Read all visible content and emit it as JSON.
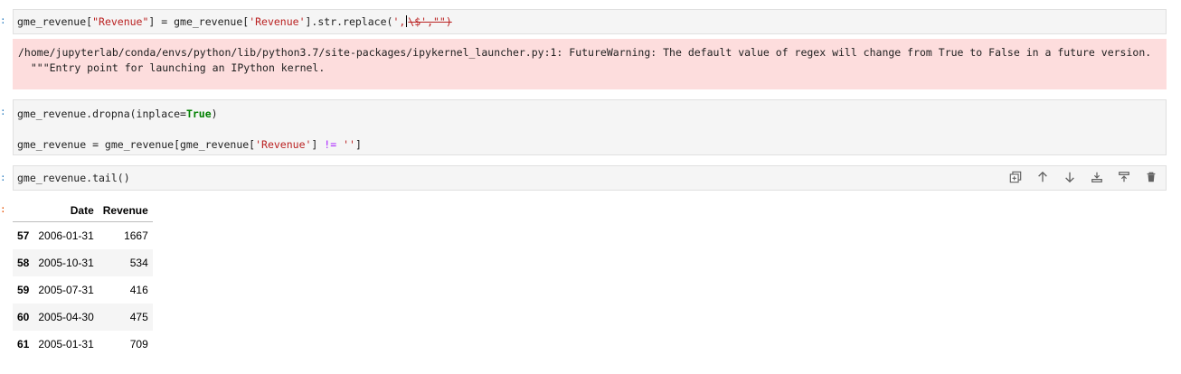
{
  "cells": [
    {
      "prompt": ":",
      "code_parts": {
        "a": "gme_revenue[",
        "b": "\"Revenue\"",
        "c": "] = gme_revenue[",
        "d": "'Revenue'",
        "e": "].str.replace(",
        "f": "',",
        "g": "\\$',\"\")"
      }
    },
    {
      "stderr": "/home/jupyterlab/conda/envs/python/lib/python3.7/site-packages/ipykernel_launcher.py:1: FutureWarning: The default value of regex will change from True to False in a future version.\n  \"\"\"Entry point for launching an IPython kernel."
    },
    {
      "prompt": ":",
      "line1": {
        "a": "gme_revenue.dropna(inplace=",
        "b": "True",
        "c": ")"
      },
      "line2": {
        "a": "gme_revenue = gme_revenue[gme_revenue[",
        "b": "'Revenue'",
        "c": "] ",
        "d": "!=",
        "e": " ",
        "f": "''",
        "g": "]"
      }
    },
    {
      "prompt": ":",
      "code": "gme_revenue.tail()"
    }
  ],
  "output_prompt": ":",
  "toolbar": [
    "duplicate-icon",
    "move-up-icon",
    "move-down-icon",
    "insert-below-icon",
    "insert-above-icon",
    "delete-icon"
  ],
  "table": {
    "columns": [
      "",
      "Date",
      "Revenue"
    ],
    "rows": [
      {
        "index": "57",
        "date": "2006-01-31",
        "revenue": "1667"
      },
      {
        "index": "58",
        "date": "2005-10-31",
        "revenue": "534"
      },
      {
        "index": "59",
        "date": "2005-07-31",
        "revenue": "416"
      },
      {
        "index": "60",
        "date": "2005-04-30",
        "revenue": "475"
      },
      {
        "index": "61",
        "date": "2005-01-31",
        "revenue": "709"
      }
    ]
  }
}
